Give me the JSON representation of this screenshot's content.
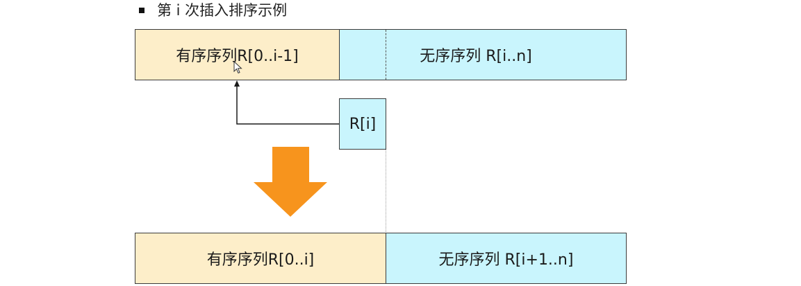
{
  "heading": {
    "text": "第 i 次插入排序示例"
  },
  "before": {
    "sorted_label": "有序序列R[0..i-1]",
    "unsorted_label": "无序序列 R[i..n]"
  },
  "current_element": {
    "label": "R[i]"
  },
  "after": {
    "sorted_label": "有序序列R[0..i]",
    "unsorted_label": "无序序列 R[i+1..n]"
  },
  "colors": {
    "sorted_fill": "#fdeec9",
    "unsorted_fill": "#c9f5fd",
    "arrow_fill": "#f7941d"
  },
  "icons": {
    "bullet": "square-bullet-icon",
    "insert_arrow": "insert-arrow-icon",
    "transition_arrow": "down-arrow-icon",
    "cursor": "mouse-cursor-icon"
  }
}
